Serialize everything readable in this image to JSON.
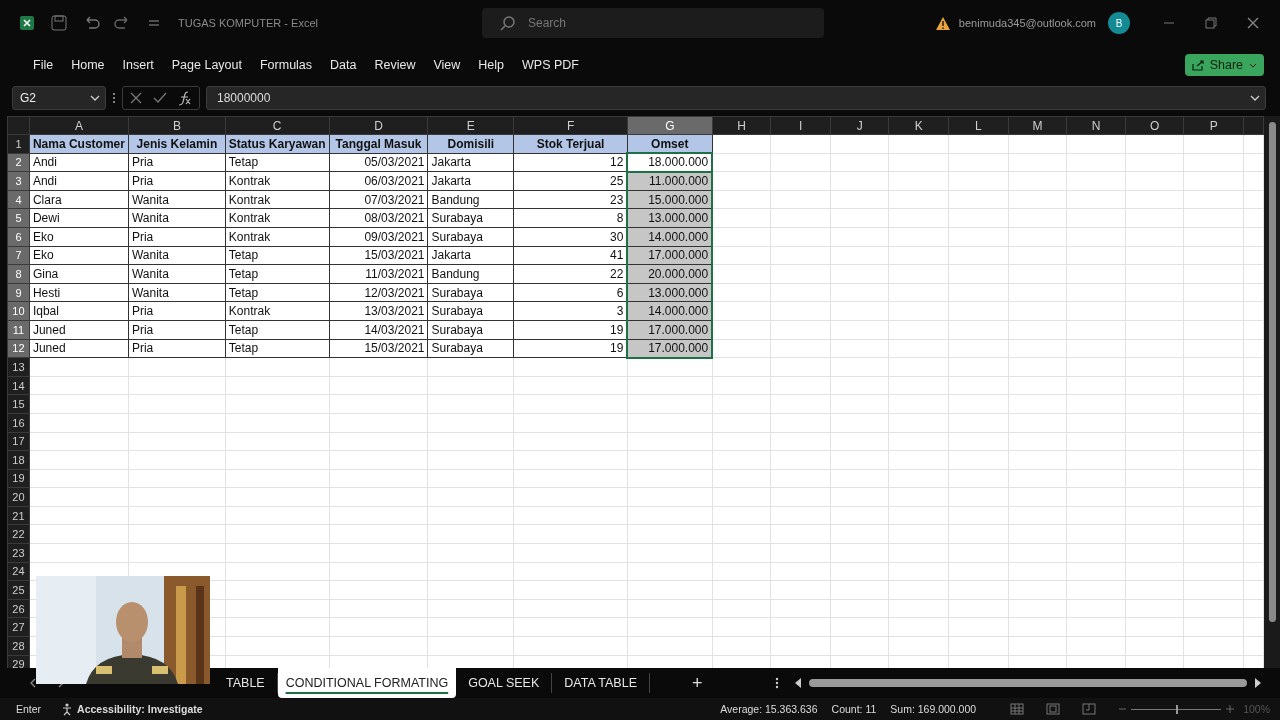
{
  "window": {
    "title": "TUGAS KOMPUTER  -  Excel",
    "account": "benimuda345@outlook.com",
    "avatar": "B"
  },
  "search": {
    "placeholder": "Search"
  },
  "menu": [
    "File",
    "Home",
    "Insert",
    "Page Layout",
    "Formulas",
    "Data",
    "Review",
    "View",
    "Help",
    "WPS PDF"
  ],
  "share_button": "Share",
  "name_box": "G2",
  "formula": "18000000",
  "columns": [
    {
      "label": "A",
      "selected": false
    },
    {
      "label": "B",
      "selected": false
    },
    {
      "label": "C",
      "selected": false
    },
    {
      "label": "D",
      "selected": false
    },
    {
      "label": "E",
      "selected": false
    },
    {
      "label": "F",
      "selected": false
    },
    {
      "label": "G",
      "selected": true
    },
    {
      "label": "H",
      "selected": false
    },
    {
      "label": "I",
      "selected": false
    },
    {
      "label": "J",
      "selected": false
    },
    {
      "label": "K",
      "selected": false
    },
    {
      "label": "L",
      "selected": false
    },
    {
      "label": "M",
      "selected": false
    },
    {
      "label": "N",
      "selected": false
    },
    {
      "label": "O",
      "selected": false
    },
    {
      "label": "P",
      "selected": false
    }
  ],
  "header_row": {
    "number": "1",
    "cells": [
      "Nama Customer",
      "Jenis Kelamin",
      "Status Karyawan",
      "Tanggal Masuk",
      "Domisili",
      "Stok Terjual",
      "Omset"
    ]
  },
  "rows": [
    {
      "number": "2",
      "selected": true,
      "active": true,
      "cells": [
        "Andi",
        "Pria",
        "Tetap",
        "05/03/2021",
        "Jakarta",
        "12",
        "18.000.000"
      ]
    },
    {
      "number": "3",
      "selected": true,
      "active": false,
      "cells": [
        "Andi",
        "Pria",
        "Kontrak",
        "06/03/2021",
        "Jakarta",
        "25",
        "11.000.000"
      ]
    },
    {
      "number": "4",
      "selected": true,
      "active": false,
      "cells": [
        "Clara",
        "Wanita",
        "Kontrak",
        "07/03/2021",
        "Bandung",
        "23",
        "15.000.000"
      ]
    },
    {
      "number": "5",
      "selected": true,
      "active": false,
      "cells": [
        "Dewi",
        "Wanita",
        "Kontrak",
        "08/03/2021",
        "Surabaya",
        "8",
        "13.000.000"
      ]
    },
    {
      "number": "6",
      "selected": true,
      "active": false,
      "cells": [
        "Eko",
        "Pria",
        "Kontrak",
        "09/03/2021",
        "Surabaya",
        "30",
        "14.000.000"
      ]
    },
    {
      "number": "7",
      "selected": true,
      "active": false,
      "cells": [
        "Eko",
        "Wanita",
        "Tetap",
        "15/03/2021",
        "Jakarta",
        "41",
        "17.000.000"
      ]
    },
    {
      "number": "8",
      "selected": true,
      "active": false,
      "cells": [
        "Gina",
        "Wanita",
        "Tetap",
        "11/03/2021",
        "Bandung",
        "22",
        "20.000.000"
      ]
    },
    {
      "number": "9",
      "selected": true,
      "active": false,
      "cells": [
        "Hesti",
        "Wanita",
        "Tetap",
        "12/03/2021",
        "Surabaya",
        "6",
        "13.000.000"
      ]
    },
    {
      "number": "10",
      "selected": true,
      "active": false,
      "cells": [
        "Iqbal",
        "Pria",
        "Kontrak",
        "13/03/2021",
        "Surabaya",
        "3",
        "14.000.000"
      ]
    },
    {
      "number": "11",
      "selected": true,
      "active": false,
      "cells": [
        "Juned",
        "Pria",
        "Tetap",
        "14/03/2021",
        "Surabaya",
        "19",
        "17.000.000"
      ]
    },
    {
      "number": "12",
      "selected": true,
      "active": false,
      "cells": [
        "Juned",
        "Pria",
        "Tetap",
        "15/03/2021",
        "Surabaya",
        "19",
        "17.000.000"
      ]
    }
  ],
  "empty_rows": [
    "13",
    "14",
    "15",
    "16",
    "17",
    "18",
    "19",
    "20",
    "21",
    "22",
    "23",
    "24",
    "25",
    "26",
    "27",
    "28",
    "29"
  ],
  "webcam": {
    "kind": "picture"
  },
  "sheet_tabs": [
    {
      "label": "TABLE",
      "selected": false
    },
    {
      "label": "CONDITIONAL FORMATING",
      "selected": true
    },
    {
      "label": "GOAL SEEK",
      "selected": false
    },
    {
      "label": "DATA TABLE",
      "selected": false
    }
  ],
  "add_sheet": "+",
  "status_bar": {
    "mode": "Enter",
    "accessibility": "Accessibility: Investigate",
    "average": "Average:  15.363.636",
    "count": "Count: 11",
    "sum": "Sum:  169.000.000",
    "zoom": {
      "level": 0.5
    },
    "zoom_reading": "100%"
  }
}
